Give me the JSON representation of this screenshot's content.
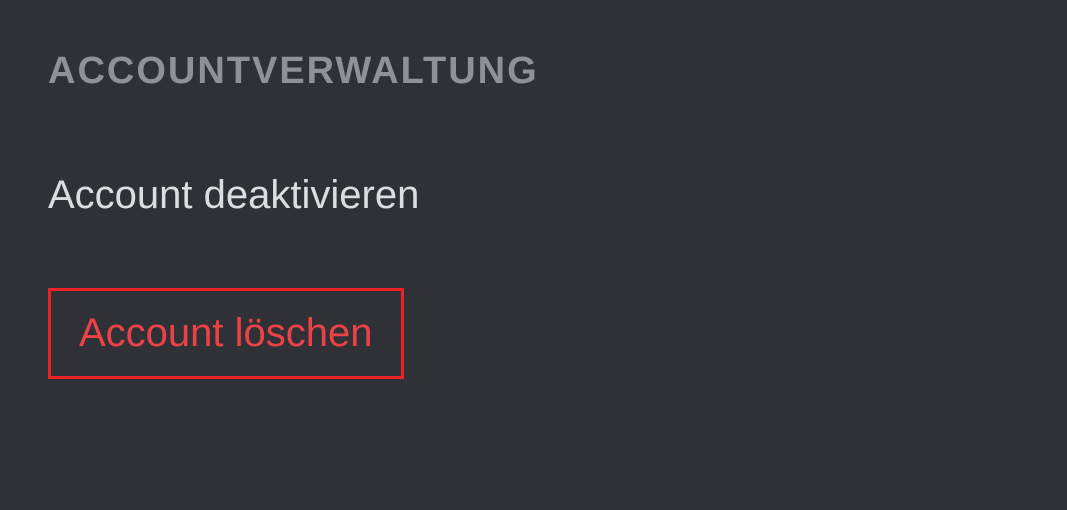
{
  "section": {
    "heading": "ACCOUNTVERWALTUNG",
    "deactivate_label": "Account deaktivieren",
    "delete_label": "Account löschen"
  }
}
